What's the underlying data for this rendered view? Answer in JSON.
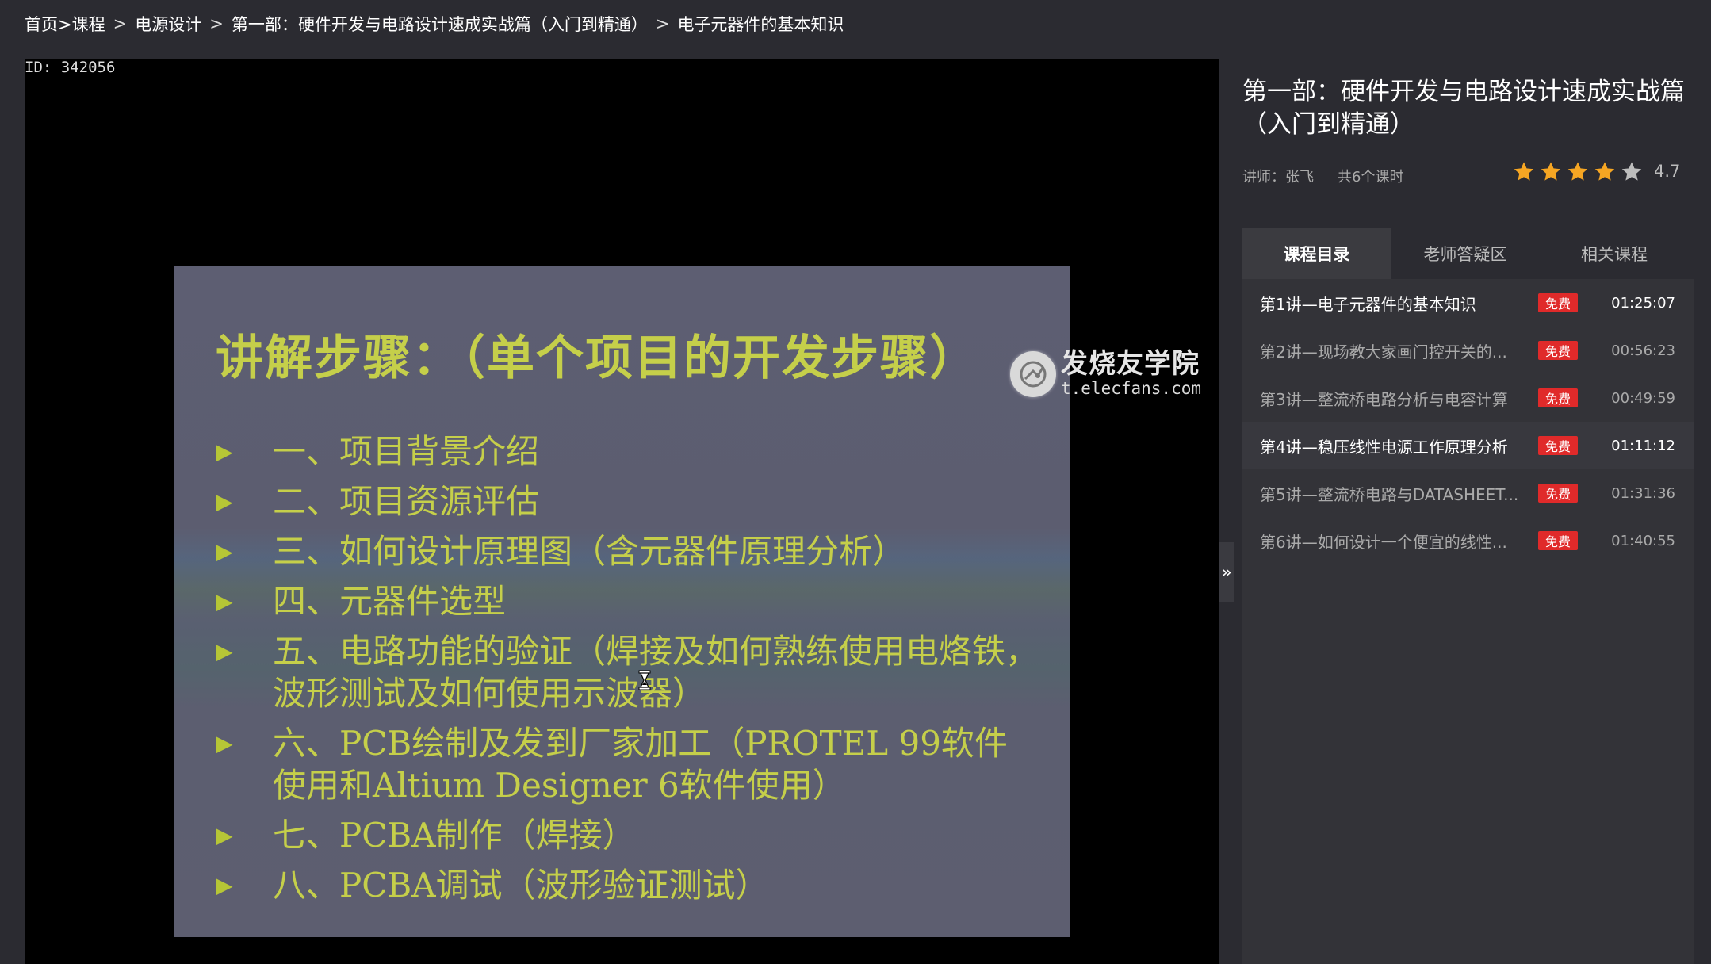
{
  "breadcrumb": [
    {
      "label": "首页>课程"
    },
    {
      "label": "电源设计"
    },
    {
      "label": "第一部：硬件开发与电路设计速成实战篇（入门到精通）"
    },
    {
      "label": "电子元器件的基本知识"
    }
  ],
  "player": {
    "video_id": "ID: 342056",
    "slide_title": "讲解步骤：（单个项目的开发步骤）",
    "slide_items": [
      "一、项目背景介绍",
      "二、项目资源评估",
      "三、如何设计原理图（含元器件原理分析）",
      "四、元器件选型",
      "五、电路功能的验证（焊接及如何熟练使用电烙铁，波形测试及如何使用示波器）",
      "六、PCB绘制及发到厂家加工（PROTEL 99软件使用和Altium Designer 6软件使用）",
      "七、PCBA制作（焊接）",
      "八、PCBA调试（波形验证测试）"
    ],
    "bullet_glyph": "▶",
    "watermark_cn": "发烧友学院",
    "watermark_en": "t.elecfans.com"
  },
  "collapse_handle": "»",
  "course": {
    "title": "第一部：硬件开发与电路设计速成实战篇（入门到精通）",
    "instructor": "讲师：张飞",
    "lesson_count": "共6个课时",
    "rating": "4.7",
    "stars": 4.7
  },
  "tabs": [
    {
      "label": "课程目录",
      "active": true
    },
    {
      "label": "老师答疑区",
      "active": false
    },
    {
      "label": "相关课程",
      "active": false
    }
  ],
  "lessons": [
    {
      "title": "第1讲—电子元器件的基本知识",
      "badge": "免费",
      "duration": "01:25:07"
    },
    {
      "title": "第2讲—现场教大家画门控开关的...",
      "badge": "免费",
      "duration": "00:56:23"
    },
    {
      "title": "第3讲—整流桥电路分析与电容计算",
      "badge": "免费",
      "duration": "00:49:59"
    },
    {
      "title": "第4讲—稳压线性电源工作原理分析",
      "badge": "免费",
      "duration": "01:11:12"
    },
    {
      "title": "第5讲—整流桥电路与DATASHEET...",
      "badge": "免费",
      "duration": "01:31:36"
    },
    {
      "title": "第6讲—如何设计一个便宜的线性...",
      "badge": "免费",
      "duration": "01:40:55"
    }
  ],
  "colors": {
    "accent_star": "#f6a623",
    "badge_red": "#e02a2a",
    "slide_text": "#c5cf4a"
  }
}
